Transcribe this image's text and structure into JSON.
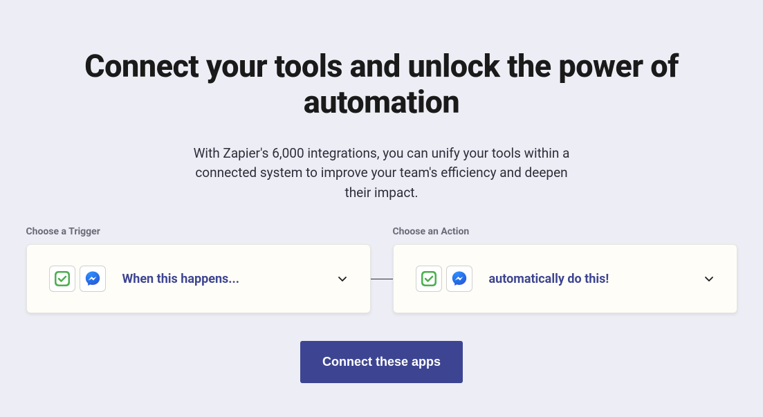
{
  "heading": "Connect your tools and unlock the power of automation",
  "subheading": "With Zapier's 6,000 integrations, you can unify your tools within a connected system to improve your team's efficiency and deepen their impact.",
  "trigger": {
    "label": "Choose a Trigger",
    "text": "When this happens..."
  },
  "action": {
    "label": "Choose an Action",
    "text": "automatically do this!"
  },
  "button": {
    "connect": "Connect these apps"
  },
  "colors": {
    "primary": "#3d4592",
    "background": "#edeef5",
    "cardBg": "#fffdf7"
  }
}
